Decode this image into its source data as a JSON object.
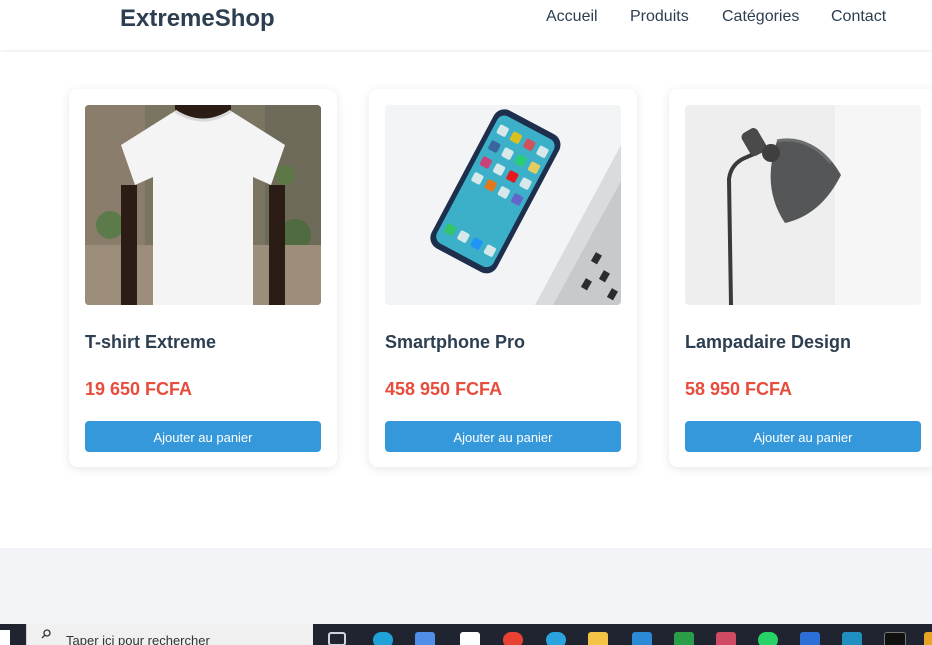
{
  "header": {
    "logo": "ExtremeShop",
    "nav": [
      "Accueil",
      "Produits",
      "Catégories",
      "Contact"
    ]
  },
  "products": [
    {
      "title": "T-shirt Extreme",
      "price": "19 650 FCFA",
      "button": "Ajouter au panier"
    },
    {
      "title": "Smartphone Pro",
      "price": "458 950 FCFA",
      "button": "Ajouter au panier"
    },
    {
      "title": "Lampadaire Design",
      "price": "58 950 FCFA",
      "button": "Ajouter au panier"
    }
  ],
  "taskbar": {
    "search_placeholder": "Taper ici pour rechercher",
    "apps": [
      "task-view-icon",
      "edge-icon",
      "store-icon",
      "app-icon",
      "chrome-icon",
      "telegram-icon",
      "file-explorer-icon",
      "vscode-icon",
      "green-app-icon",
      "git-icon",
      "whatsapp-icon",
      "blue-app-icon",
      "teal-app-icon",
      "dark-app-icon",
      "orange-app-icon"
    ]
  },
  "colors": {
    "brand_text": "#2c3e50",
    "price": "#e74c3c",
    "button": "#3498db",
    "footer": "#f3f4f7"
  }
}
